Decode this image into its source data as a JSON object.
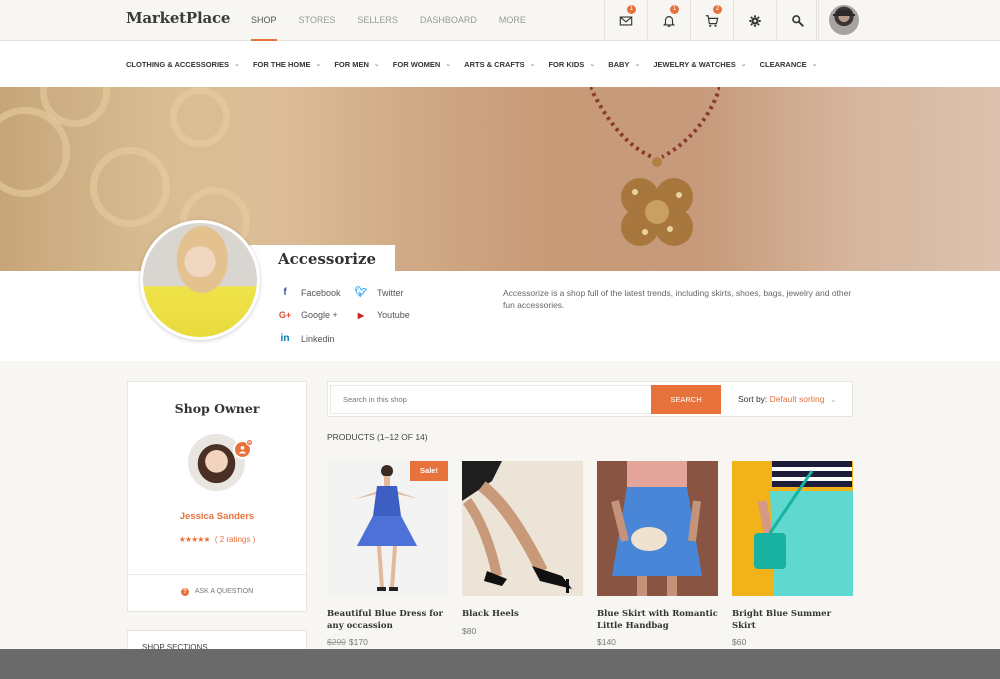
{
  "header": {
    "logo": "MarketPlace",
    "nav": [
      {
        "label": "SHOP",
        "active": true
      },
      {
        "label": "STORES",
        "active": false
      },
      {
        "label": "SELLERS",
        "active": false
      },
      {
        "label": "DASHBOARD",
        "active": false
      },
      {
        "label": "MORE",
        "active": false
      }
    ],
    "icons": [
      {
        "name": "mail-icon",
        "badge": "1"
      },
      {
        "name": "bell-icon",
        "badge": "1"
      },
      {
        "name": "cart-icon",
        "badge": "2"
      },
      {
        "name": "gear-icon",
        "badge": ""
      },
      {
        "name": "search-icon",
        "badge": ""
      }
    ]
  },
  "categories": [
    "CLOTHING & ACCESSORIES",
    "FOR THE HOME",
    "FOR MEN",
    "FOR WOMEN",
    "ARTS & CRAFTS",
    "FOR KIDS",
    "BABY",
    "JEWELRY & WATCHES",
    "CLEARANCE"
  ],
  "shop": {
    "name": "Accessorize",
    "description": "Accessorize is a shop full of the latest trends, including skirts, shoes, bags, jewelry and other fun accessories.",
    "socials": {
      "facebook": "Facebook",
      "twitter": "Twitter",
      "googleplus": "Google +",
      "youtube": "Youtube",
      "linkedin": "Linkedin"
    }
  },
  "owner": {
    "title": "Shop Owner",
    "name": "Jessica Sanders",
    "stars": "★★★★★",
    "ratings": "( 2 ratings )",
    "ask": "ASK A QUESTION"
  },
  "sections": {
    "title": "SHOP SECTIONS"
  },
  "search": {
    "placeholder": "Search in this shop",
    "button": "SEARCH",
    "sort_label": "Sort by:",
    "sort_value": "Default sorting"
  },
  "results": "PRODUCTS (1–12 OF 14)",
  "products": [
    {
      "title": "Beautiful Blue Dress for any occassion",
      "old_price": "$299",
      "price": "$170",
      "badge": "Sale!"
    },
    {
      "title": "Black Heels",
      "old_price": "",
      "price": "$80",
      "badge": ""
    },
    {
      "title": "Blue Skirt with Romantic Little Handbag",
      "old_price": "",
      "price": "$140",
      "badge": ""
    },
    {
      "title": "Bright Blue Summer Skirt",
      "old_price": "",
      "price": "$60",
      "badge": ""
    }
  ],
  "colors": {
    "accent": "#e8723c",
    "background": "#f8f6f3"
  }
}
